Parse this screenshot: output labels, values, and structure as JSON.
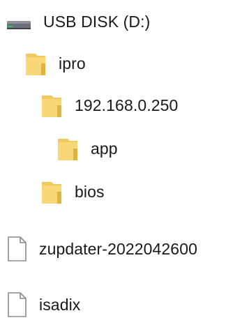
{
  "tree": {
    "drive": {
      "label": "USB DISK (D:)",
      "icon": "usb-drive-icon"
    },
    "items": [
      {
        "label": "ipro",
        "icon": "folder-icon"
      },
      {
        "label": "192.168.0.250",
        "icon": "folder-icon"
      },
      {
        "label": "app",
        "icon": "folder-icon"
      },
      {
        "label": "bios",
        "icon": "folder-icon"
      }
    ],
    "files": [
      {
        "label": "zupdater-2022042600",
        "icon": "file-icon"
      },
      {
        "label": "isadix",
        "icon": "file-icon"
      }
    ]
  },
  "colors": {
    "folder_fill": "#F5CF6A",
    "folder_shadow": "#E0AE35",
    "file_stroke": "#8A8A8A",
    "drive_body": "#5A5F66",
    "drive_led": "#2FCB57"
  }
}
